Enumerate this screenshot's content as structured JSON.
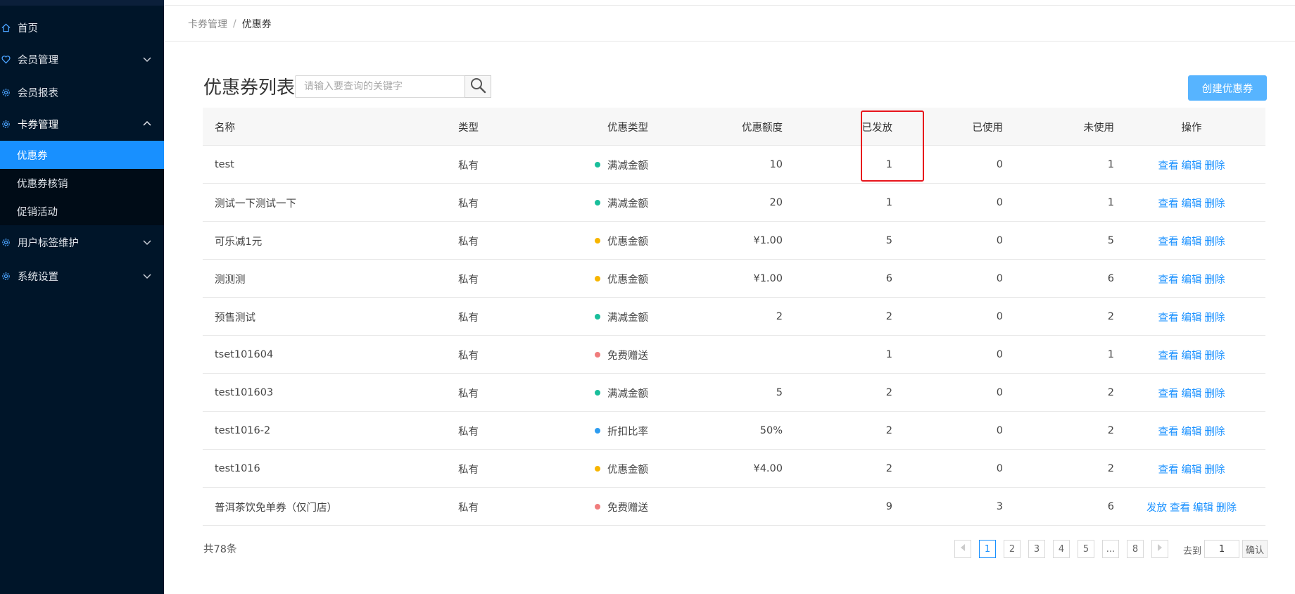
{
  "sidebar": {
    "items": [
      {
        "label": "首页",
        "icon": "home-icon"
      },
      {
        "label": "会员管理",
        "icon": "heart-icon"
      },
      {
        "label": "会员报表",
        "icon": "gear-icon"
      },
      {
        "label": "卡券管理",
        "icon": "gear-icon"
      },
      {
        "label": "用户标签维护",
        "icon": "gear-icon"
      },
      {
        "label": "系统设置",
        "icon": "gear-icon"
      }
    ],
    "sub_items": [
      {
        "label": "优惠券"
      },
      {
        "label": "优惠券核销"
      },
      {
        "label": "促销活动"
      }
    ]
  },
  "breadcrumb": {
    "parent": "卡券管理",
    "separator": "/",
    "current": "优惠券"
  },
  "page": {
    "title": "优惠券列表",
    "search_placeholder": "请输入要查询的关键字",
    "create_button": "创建优惠券"
  },
  "table": {
    "columns": {
      "name": "名称",
      "type": "类型",
      "discount_type": "优惠类型",
      "amount": "优惠额度",
      "issued": "已发放",
      "used": "已使用",
      "unused": "未使用",
      "ops": "操作"
    },
    "rows": [
      {
        "name": "test",
        "type": "私有",
        "discount_type": "满减金额",
        "dot_color": "#19be9b",
        "amount": "10",
        "issued": "1",
        "used": "0",
        "unused": "1",
        "ops": [
          "查看",
          "编辑",
          "删除"
        ]
      },
      {
        "name": "测试一下测试一下",
        "type": "私有",
        "discount_type": "满减金额",
        "dot_color": "#19be9b",
        "amount": "20",
        "issued": "1",
        "used": "0",
        "unused": "1",
        "ops": [
          "查看",
          "编辑",
          "删除"
        ]
      },
      {
        "name": "可乐减1元",
        "type": "私有",
        "discount_type": "优惠金额",
        "dot_color": "#f7b500",
        "amount": "¥1.00",
        "issued": "5",
        "used": "0",
        "unused": "5",
        "ops": [
          "查看",
          "编辑",
          "删除"
        ]
      },
      {
        "name": "测测测",
        "type": "私有",
        "discount_type": "优惠金额",
        "dot_color": "#f7b500",
        "amount": "¥1.00",
        "issued": "6",
        "used": "0",
        "unused": "6",
        "ops": [
          "查看",
          "编辑",
          "删除"
        ]
      },
      {
        "name": "预售测试",
        "type": "私有",
        "discount_type": "满减金额",
        "dot_color": "#19be9b",
        "amount": "2",
        "issued": "2",
        "used": "0",
        "unused": "2",
        "ops": [
          "查看",
          "编辑",
          "删除"
        ]
      },
      {
        "name": "tset101604",
        "type": "私有",
        "discount_type": "免费赠送",
        "dot_color": "#f07c7c",
        "amount": "",
        "issued": "1",
        "used": "0",
        "unused": "1",
        "ops": [
          "查看",
          "编辑",
          "删除"
        ]
      },
      {
        "name": "test101603",
        "type": "私有",
        "discount_type": "满减金额",
        "dot_color": "#19be9b",
        "amount": "5",
        "issued": "2",
        "used": "0",
        "unused": "2",
        "ops": [
          "查看",
          "编辑",
          "删除"
        ]
      },
      {
        "name": "test1016-2",
        "type": "私有",
        "discount_type": "折扣比率",
        "dot_color": "#2d9cf0",
        "amount": "50%",
        "issued": "2",
        "used": "0",
        "unused": "2",
        "ops": [
          "查看",
          "编辑",
          "删除"
        ]
      },
      {
        "name": "test1016",
        "type": "私有",
        "discount_type": "优惠金额",
        "dot_color": "#f7b500",
        "amount": "¥4.00",
        "issued": "2",
        "used": "0",
        "unused": "2",
        "ops": [
          "查看",
          "编辑",
          "删除"
        ]
      },
      {
        "name": "普洱茶饮免单券（仅门店）",
        "type": "私有",
        "discount_type": "免费赠送",
        "dot_color": "#f07c7c",
        "amount": "",
        "issued": "9",
        "used": "3",
        "unused": "6",
        "ops": [
          "发放",
          "查看",
          "编辑",
          "删除"
        ]
      }
    ]
  },
  "footer": {
    "total": "共78条",
    "pages": [
      "1",
      "2",
      "3",
      "4",
      "5",
      "...",
      "8"
    ],
    "current_page": "1",
    "goto_label": "去到",
    "goto_value": "1",
    "confirm": "确认"
  },
  "colors": {
    "sidebar_bg": "#001529",
    "active_blue": "#1890ff",
    "create_button": "#57b4ff",
    "highlight_red": "#e8141b"
  }
}
